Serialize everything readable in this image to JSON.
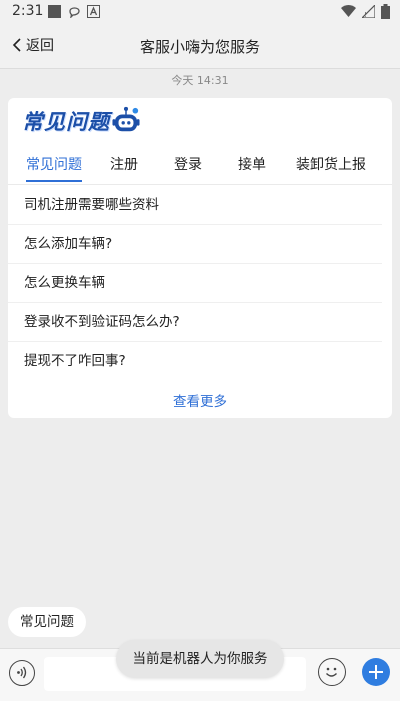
{
  "status_bar": {
    "time": "2:31",
    "icons": [
      "square-notification-icon",
      "chat-notification-icon",
      "app-a-icon",
      "wifi-icon",
      "signal-icon",
      "battery-icon"
    ]
  },
  "header": {
    "back_label": "返回",
    "title": "客服小嗨为您服务"
  },
  "timestamp": "今天  14:31",
  "faq_card": {
    "logo_text": "常见问题",
    "tabs": [
      {
        "label": "常见问题",
        "active": true
      },
      {
        "label": "注册",
        "active": false
      },
      {
        "label": "登录",
        "active": false
      },
      {
        "label": "接单",
        "active": false
      },
      {
        "label": "装卸货上报",
        "active": false
      }
    ],
    "questions": [
      "司机注册需要哪些资料",
      "怎么添加车辆?",
      "怎么更换车辆",
      "登录收不到验证码怎么办?",
      "提现不了咋回事?"
    ],
    "more_label": "查看更多"
  },
  "quick_reply": "常见问题",
  "input_bar": {
    "placeholder": ""
  },
  "toast": "当前是机器人为你服务",
  "colors": {
    "accent": "#2f6fd6",
    "background": "#ededed",
    "plus_button": "#2f7de0"
  }
}
